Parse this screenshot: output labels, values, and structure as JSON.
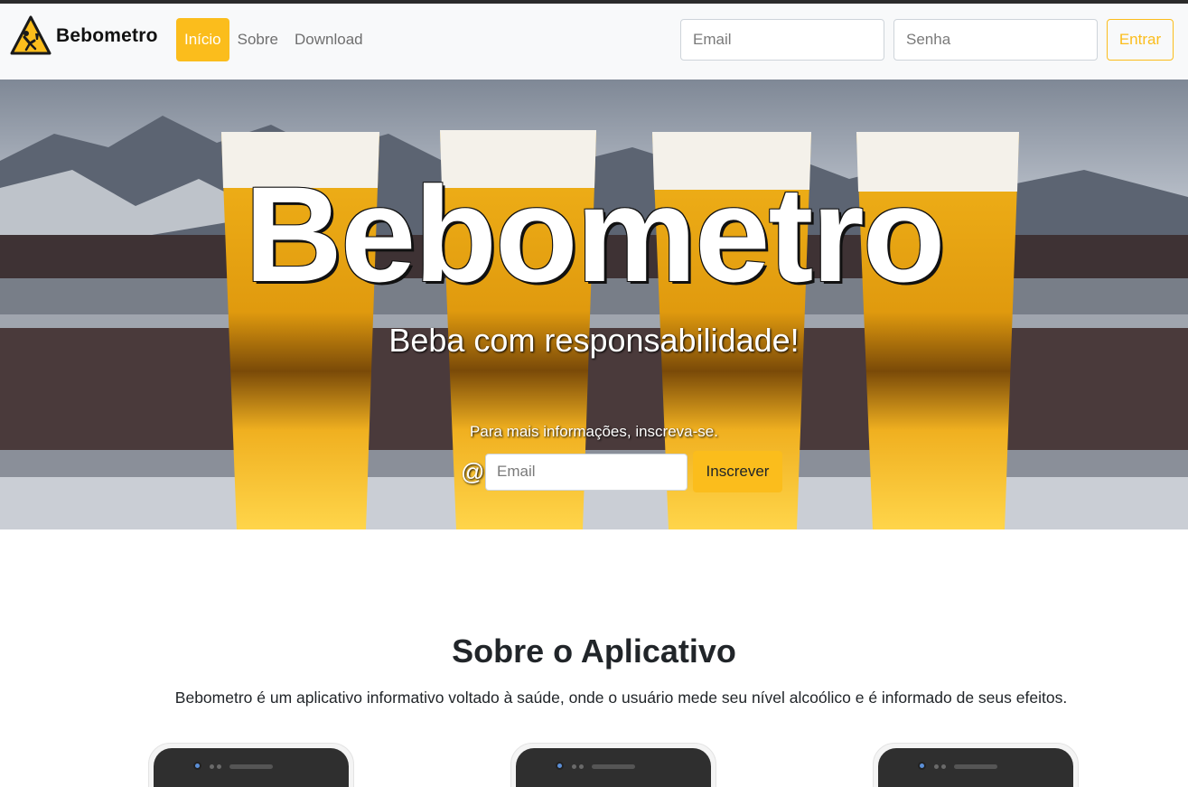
{
  "navbar": {
    "brand": "Bebometro",
    "links": [
      {
        "label": "Início",
        "active": true
      },
      {
        "label": "Sobre",
        "active": false
      },
      {
        "label": "Download",
        "active": false
      }
    ],
    "email_placeholder": "Email",
    "password_placeholder": "Senha",
    "login_label": "Entrar"
  },
  "hero": {
    "title": "Bebometro",
    "subtitle": "Beba com responsabilidade!",
    "info": "Para mais informações, inscreva-se.",
    "at_symbol": "@",
    "email_placeholder": "Email",
    "subscribe_label": "Inscrever"
  },
  "about": {
    "title": "Sobre o Aplicativo",
    "text": "Bebometro é um aplicativo informativo voltado à saúde, onde o usuário mede seu nível alcoólico e é informado de seus efeitos."
  },
  "colors": {
    "accent": "#fbbd1c",
    "navbar_bg": "#f8f9fa",
    "text": "#212529"
  },
  "icons": {
    "brand": "drunk-warning-icon",
    "phone_camera": "camera-icon"
  }
}
